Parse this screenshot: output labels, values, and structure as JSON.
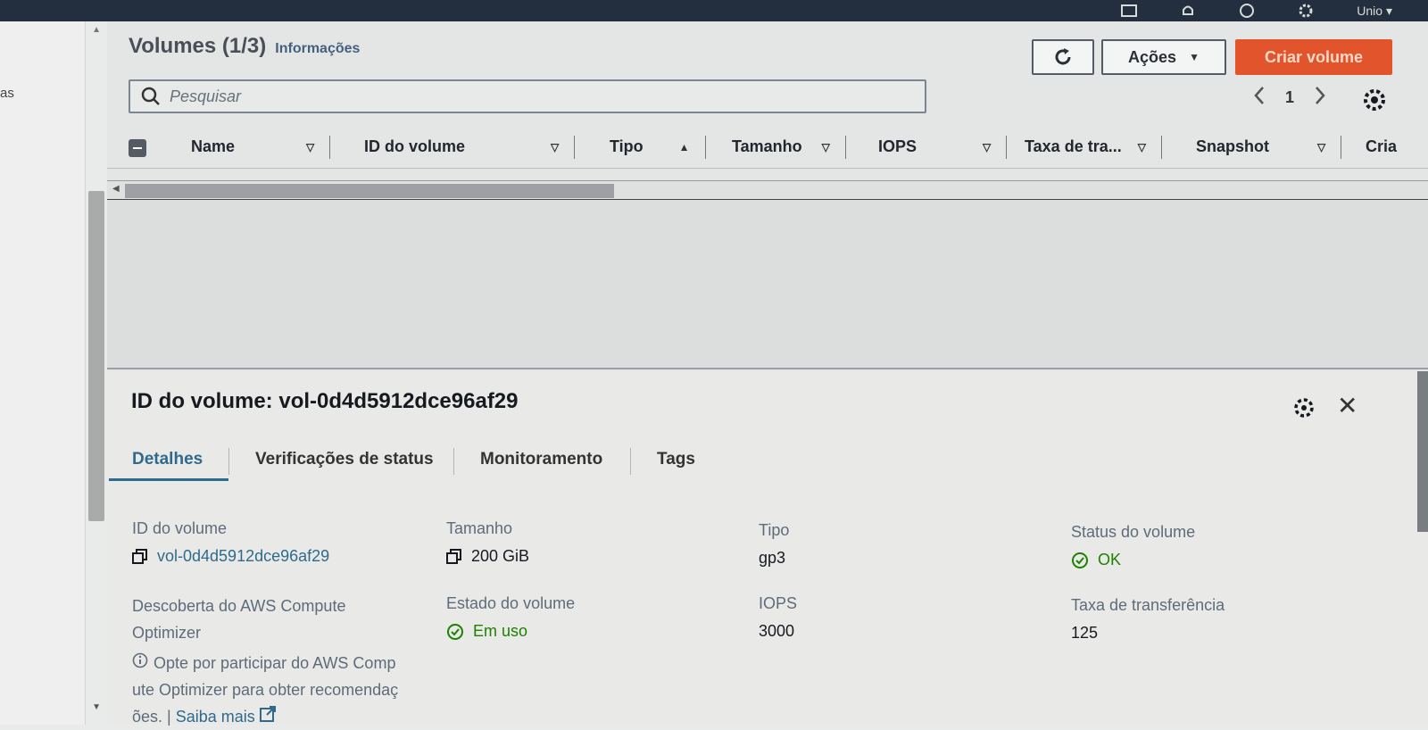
{
  "topbar": {
    "region": "Unio",
    "icons": [
      "terminal-icon",
      "bell-icon",
      "help-icon",
      "settings-icon"
    ]
  },
  "leftnav": {
    "fragment": "as"
  },
  "header": {
    "title": "Volumes (1/3)",
    "info_link": "Informações",
    "actions_label": "Ações",
    "create_label": "Criar volume"
  },
  "search": {
    "placeholder": "Pesquisar"
  },
  "pagination": {
    "current_page": "1"
  },
  "table": {
    "columns": [
      {
        "label": "Name",
        "sort": "filter"
      },
      {
        "label": "ID do volume",
        "sort": "filter"
      },
      {
        "label": "Tipo",
        "sort": "asc"
      },
      {
        "label": "Tamanho",
        "sort": "filter"
      },
      {
        "label": "IOPS",
        "sort": "filter"
      },
      {
        "label": "Taxa de tra...",
        "sort": "filter"
      },
      {
        "label": "Snapshot",
        "sort": "filter"
      },
      {
        "label": "Cria",
        "sort": "filter"
      }
    ]
  },
  "detail": {
    "title": "ID do volume: vol-0d4d5912dce96af29",
    "tabs": [
      "Detalhes",
      "Verificações de status",
      "Monitoramento",
      "Tags"
    ],
    "fields": {
      "volume_id_label": "ID do volume",
      "volume_id_value": "vol-0d4d5912dce96af29",
      "size_label": "Tamanho",
      "size_value": "200 GiB",
      "type_label": "Tipo",
      "type_value": "gp3",
      "status_label": "Status do volume",
      "status_value": "OK",
      "optimizer_label_1": "Descoberta do AWS Compute",
      "optimizer_label_2": "Optimizer",
      "optimizer_desc_1": "Opte por participar do AWS Comp",
      "optimizer_desc_2": "ute Optimizer para obter recomendaç",
      "optimizer_desc_3": "ões. |",
      "optimizer_more": "Saiba mais",
      "state_label": "Estado do volume",
      "state_value": "Em uso",
      "iops_label": "IOPS",
      "iops_value": "3000",
      "throughput_label": "Taxa de transferência",
      "throughput_value": "125"
    }
  },
  "colors": {
    "primary_button": "#e2542c",
    "link": "#2f6a8c",
    "success": "#1d8102",
    "topbar": "#232f3e"
  }
}
